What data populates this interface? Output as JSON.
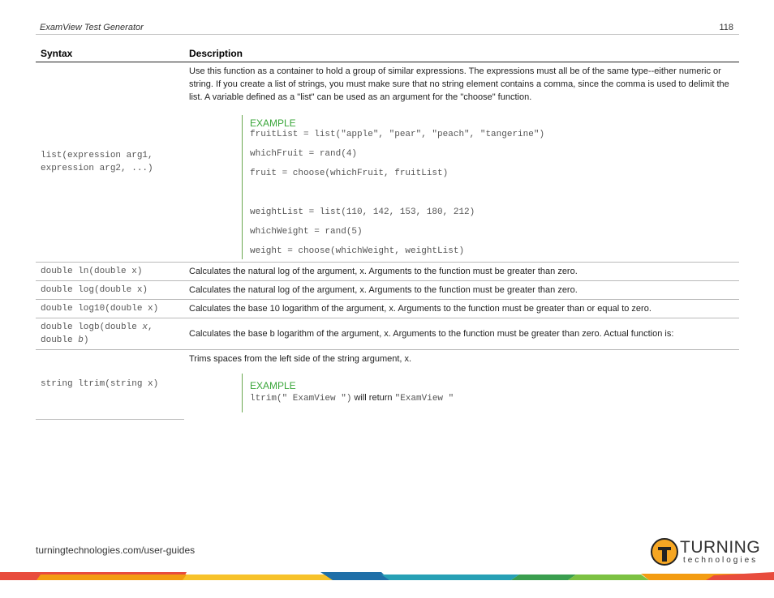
{
  "header": {
    "title": "ExamView Test Generator",
    "page_number": "118"
  },
  "table": {
    "columns": [
      "Syntax",
      "Description"
    ],
    "rows": {
      "list": {
        "syntax_line1": "list(expression arg1,",
        "syntax_line2": "expression arg2, ...)",
        "description": "Use this function as a container to hold a group of similar expressions. The expressions must all be of the same type--either numeric or string. If you create a list of strings, you must make sure that no string element contains a comma, since the comma is used to delimit the list. A variable defined as a \"list\" can be used as an argument for the \"choose\" function.",
        "example_label": "EXAMPLE",
        "code": [
          "fruitList = list(\"apple\", \"pear\", \"peach\", \"tangerine\")",
          "whichFruit = rand(4)",
          "fruit = choose(whichFruit, fruitList)",
          "weightList = list(110, 142, 153, 180, 212)",
          "whichWeight = rand(5)",
          "weight = choose(whichWeight, weightList)"
        ]
      },
      "ln": {
        "syntax": "double ln(double x)",
        "description": "Calculates the natural log of the argument, x. Arguments to the function must be greater than zero."
      },
      "log": {
        "syntax": "double log(double x)",
        "description": "Calculates the natural log of the argument, x. Arguments to the function must be greater than zero."
      },
      "log10": {
        "syntax": "double log10(double x)",
        "description": "Calculates the base 10 logarithm of the argument, x. Arguments to the function must be greater than or equal to zero."
      },
      "logb": {
        "syntax_part1": "double logb(double ",
        "syntax_x": "x",
        "syntax_part2": ",",
        "syntax_part3": "double ",
        "syntax_b": "b",
        "syntax_part4": ")",
        "description": "Calculates the base b logarithm of the argument, x. Arguments to the function must be greater than zero. Actual function is:"
      },
      "ltrim": {
        "syntax": "string ltrim(string x)",
        "description": "Trims spaces from the left side of the string argument, x.",
        "example_label": "EXAMPLE",
        "code_call": "ltrim(\" ExamView \")",
        "will_return": " will return ",
        "result": "\"ExamView \""
      }
    }
  },
  "footer": {
    "url": "turningtechnologies.com/user-guides"
  },
  "logo": {
    "word": "TURNING",
    "sub": "technologies"
  },
  "colors": {
    "example_green": "#3aa63a",
    "logo_orange": "#f5a623"
  }
}
